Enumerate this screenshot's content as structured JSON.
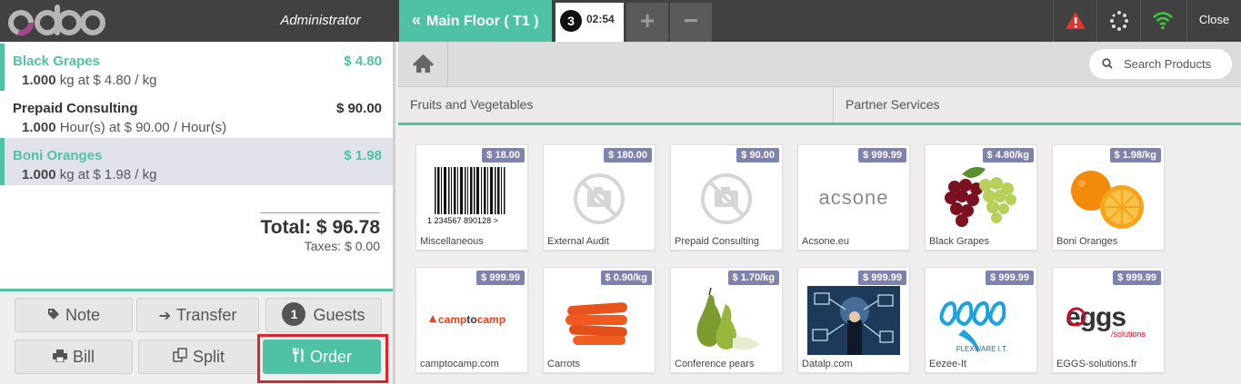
{
  "header": {
    "user": "Administrator",
    "floor_button": "Main Floor ( T1 )",
    "order_count": "3",
    "order_time": "02:54",
    "add_label": "+",
    "remove_label": "−",
    "close_label": "Close"
  },
  "order": {
    "lines": [
      {
        "name": "Black Grapes",
        "price": "$ 4.80",
        "qty": "1.000",
        "info": "kg at $ 4.80 / kg"
      },
      {
        "name": "Prepaid Consulting",
        "price": "$ 90.00",
        "qty": "1.000",
        "info": "Hour(s) at $ 90.00 / Hour(s)"
      },
      {
        "name": "Boni Oranges",
        "price": "$ 1.98",
        "qty": "1.000",
        "info": "kg at $ 1.98 / kg"
      }
    ],
    "total": "Total: $ 96.78",
    "taxes": "Taxes: $ 0.00"
  },
  "actions": {
    "note": "Note",
    "transfer": "Transfer",
    "guests_count": "1",
    "guests": "Guests",
    "bill": "Bill",
    "split": "Split",
    "order": "Order"
  },
  "search": {
    "placeholder": "Search Products"
  },
  "categories": [
    "Fruits and Vegetables",
    "Partner Services"
  ],
  "products": [
    {
      "name": "Miscellaneous",
      "price": "$ 18.00",
      "icon": "barcode"
    },
    {
      "name": "External Audit",
      "price": "$ 180.00",
      "icon": "no-photo"
    },
    {
      "name": "Prepaid Consulting",
      "price": "$ 90.00",
      "icon": "no-photo"
    },
    {
      "name": "Acsone.eu",
      "price": "$ 999.99",
      "icon": "acsone-logo"
    },
    {
      "name": "Black Grapes",
      "price": "$ 4.80/kg",
      "icon": "grapes"
    },
    {
      "name": "Boni Oranges",
      "price": "$ 1.98/kg",
      "icon": "oranges"
    },
    {
      "name": "camptocamp.com",
      "price": "$ 999.99",
      "icon": "camptocamp-logo"
    },
    {
      "name": "Carrots",
      "price": "$ 0.90/kg",
      "icon": "carrots"
    },
    {
      "name": "Conference pears",
      "price": "$ 1.70/kg",
      "icon": "pears"
    },
    {
      "name": "Datalp.com",
      "price": "$ 999.99",
      "icon": "datalp-image"
    },
    {
      "name": "Eezee-It",
      "price": "$ 999.99",
      "icon": "eezee-logo"
    },
    {
      "name": "EGGS-solutions.fr",
      "price": "$ 999.99",
      "icon": "eggs-logo"
    }
  ],
  "logos": {
    "barcode_text": "1 234567 890128 >",
    "acsone": "acsone",
    "camptocamp_a": "camp",
    "camptocamp_b": "to",
    "camptocamp_c": "camp",
    "eezee_tag": "FLEXWARE I.T.",
    "eggs_main": "eggs",
    "eggs_sub": "/solutions"
  },
  "colors": {
    "accent": "#4fc2a6",
    "topbar": "#414141",
    "price_tag": "#7f82ac",
    "highlight": "#d9252b",
    "warning": "#e3342f",
    "wifi": "#3cc43c"
  }
}
